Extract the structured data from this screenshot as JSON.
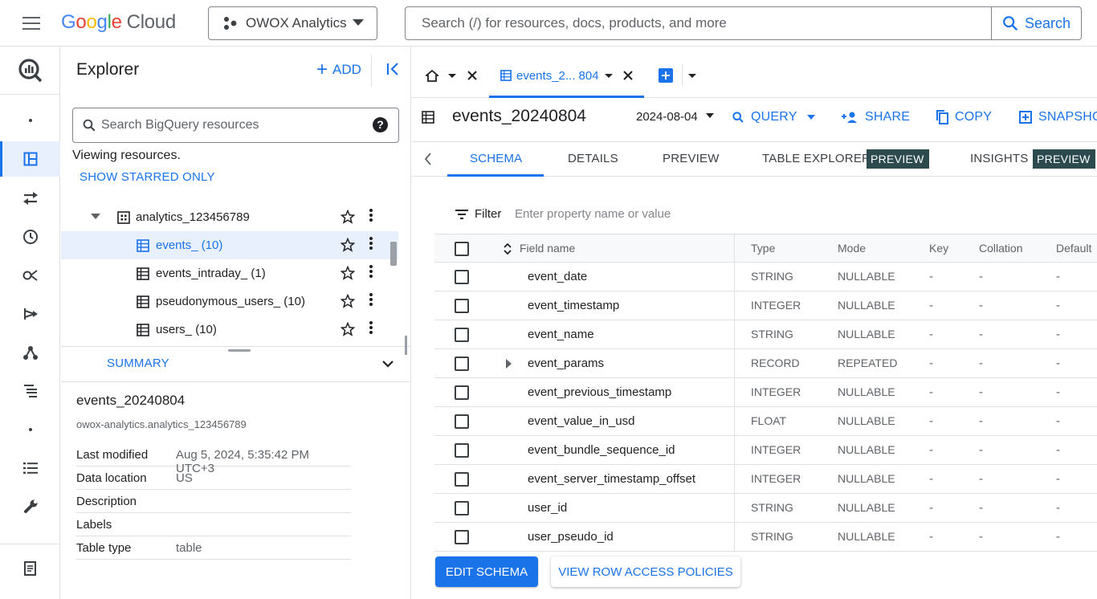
{
  "header": {
    "logo_text": [
      "G",
      "o",
      "o",
      "g",
      "l",
      "e"
    ],
    "logo_suffix": "Cloud",
    "project": "OWOX Analytics",
    "search_placeholder": "Search (/) for resources, docs, products, and more",
    "search_button": "Search"
  },
  "explorer": {
    "title": "Explorer",
    "add_label": "ADD",
    "search_placeholder": "Search BigQuery resources",
    "viewing_text": "Viewing resources.",
    "show_starred": "SHOW STARRED ONLY",
    "tree": [
      {
        "label": "analytics_123456789",
        "kind": "dataset",
        "selected": false
      },
      {
        "label": "events_ (10)",
        "kind": "table",
        "selected": true
      },
      {
        "label": "events_intraday_ (1)",
        "kind": "table",
        "selected": false
      },
      {
        "label": "pseudonymous_users_ (10)",
        "kind": "table",
        "selected": false
      },
      {
        "label": "users_ (10)",
        "kind": "table",
        "selected": false
      }
    ],
    "summary_tab": "SUMMARY",
    "summary": {
      "name": "events_20240804",
      "path": "owox-analytics.analytics_123456789",
      "properties": [
        {
          "key": "Last modified",
          "value": "Aug 5, 2024, 5:35:42 PM UTC+3"
        },
        {
          "key": "Data location",
          "value": "US"
        },
        {
          "key": "Description",
          "value": ""
        },
        {
          "key": "Labels",
          "value": ""
        },
        {
          "key": "Table type",
          "value": "table"
        }
      ]
    }
  },
  "main": {
    "tab_label": "events_2... 804",
    "table_title": "events_20240804",
    "date": "2024-08-04",
    "actions": {
      "query": "QUERY",
      "share": "SHARE",
      "copy": "COPY",
      "snapshot": "SNAPSHOT"
    },
    "subtabs": {
      "schema": "SCHEMA",
      "details": "DETAILS",
      "preview": "PREVIEW",
      "table_explorer": "TABLE EXPLORER",
      "insights": "INSIGHTS",
      "badge": "PREVIEW"
    },
    "filter_label": "Filter",
    "filter_placeholder": "Enter property name or value",
    "columns": {
      "name": "Field name",
      "type": "Type",
      "mode": "Mode",
      "key": "Key",
      "collation": "Collation",
      "default": "Default"
    },
    "rows": [
      {
        "name": "event_date",
        "type": "STRING",
        "mode": "NULLABLE",
        "key": "-",
        "collation": "-",
        "default": "-",
        "expandable": false
      },
      {
        "name": "event_timestamp",
        "type": "INTEGER",
        "mode": "NULLABLE",
        "key": "-",
        "collation": "-",
        "default": "-",
        "expandable": false
      },
      {
        "name": "event_name",
        "type": "STRING",
        "mode": "NULLABLE",
        "key": "-",
        "collation": "-",
        "default": "-",
        "expandable": false
      },
      {
        "name": "event_params",
        "type": "RECORD",
        "mode": "REPEATED",
        "key": "-",
        "collation": "-",
        "default": "-",
        "expandable": true
      },
      {
        "name": "event_previous_timestamp",
        "type": "INTEGER",
        "mode": "NULLABLE",
        "key": "-",
        "collation": "-",
        "default": "-",
        "expandable": false
      },
      {
        "name": "event_value_in_usd",
        "type": "FLOAT",
        "mode": "NULLABLE",
        "key": "-",
        "collation": "-",
        "default": "-",
        "expandable": false
      },
      {
        "name": "event_bundle_sequence_id",
        "type": "INTEGER",
        "mode": "NULLABLE",
        "key": "-",
        "collation": "-",
        "default": "-",
        "expandable": false
      },
      {
        "name": "event_server_timestamp_offset",
        "type": "INTEGER",
        "mode": "NULLABLE",
        "key": "-",
        "collation": "-",
        "default": "-",
        "expandable": false
      },
      {
        "name": "user_id",
        "type": "STRING",
        "mode": "NULLABLE",
        "key": "-",
        "collation": "-",
        "default": "-",
        "expandable": false
      },
      {
        "name": "user_pseudo_id",
        "type": "STRING",
        "mode": "NULLABLE",
        "key": "-",
        "collation": "-",
        "default": "-",
        "expandable": false
      }
    ],
    "edit_schema": "EDIT SCHEMA",
    "row_access": "VIEW ROW ACCESS POLICIES"
  },
  "colors": {
    "accent": "#1a73e8",
    "badge": "#2d4a4f",
    "selected_bg": "#e8f0fe"
  }
}
